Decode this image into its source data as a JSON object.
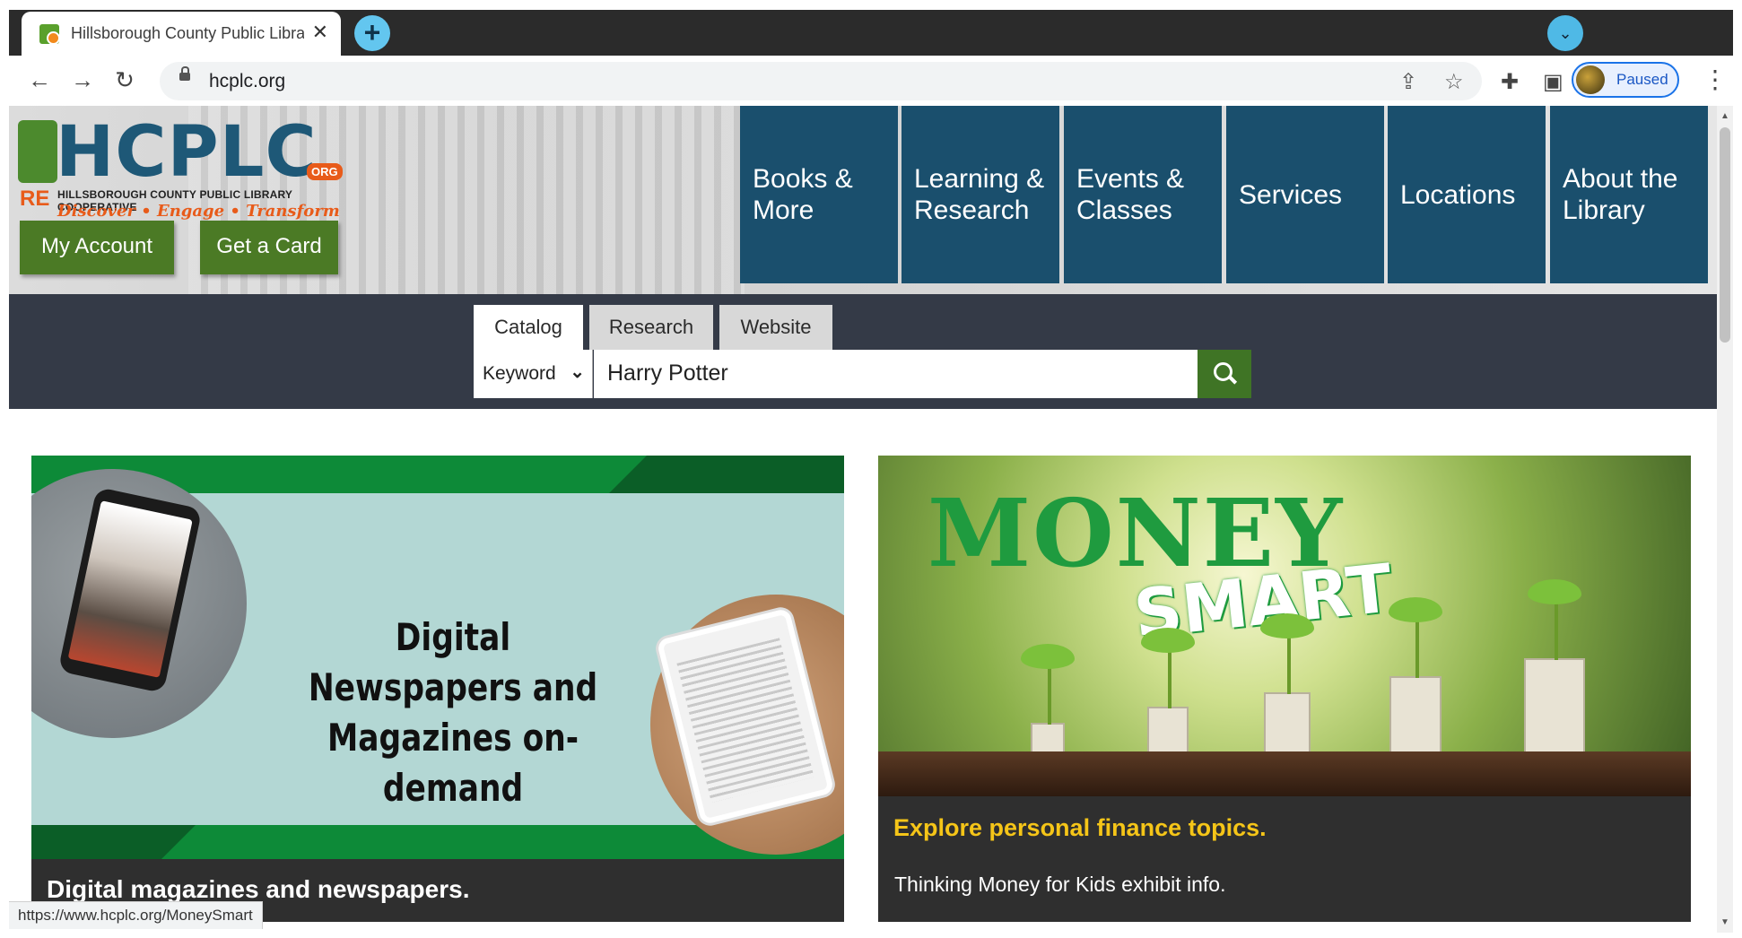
{
  "browser": {
    "tab_title": "Hillsborough County Public Library Cooperative",
    "new_tab_icon": "plus-icon",
    "url": "hcplc.org",
    "profile_label": "Paused",
    "status_url": "https://www.hcplc.org/MoneySmart"
  },
  "header": {
    "logo_text": "HCPLC",
    "logo_org": "ORG",
    "logo_re": "RE",
    "logo_subtitle": "HILLSBOROUGH COUNTY PUBLIC LIBRARY COOPERATIVE",
    "logo_tagline": "Discover • Engage • Transform",
    "my_account": "My Account",
    "get_card": "Get a Card",
    "nav": [
      {
        "line1": "Books &",
        "line2": "More"
      },
      {
        "line1": "Learning &",
        "line2": "Research"
      },
      {
        "line1": "Events &",
        "line2": "Classes"
      },
      {
        "line1": "Services",
        "line2": ""
      },
      {
        "line1": "Locations",
        "line2": ""
      },
      {
        "line1": "About the",
        "line2": "Library"
      }
    ]
  },
  "search": {
    "tabs": [
      "Catalog",
      "Research",
      "Website"
    ],
    "active_tab": "Catalog",
    "scope": "Keyword",
    "query": "Harry Potter"
  },
  "cards": [
    {
      "image_heading_line1": "Digital Newspapers and",
      "image_heading_line2": "Magazines on-demand",
      "caption": "Digital magazines and newspapers."
    },
    {
      "image_title1": "MONEY",
      "image_title2": "SMART",
      "caption": "Explore personal finance topics.",
      "subcaption": "Thinking Money for Kids exhibit info."
    }
  ],
  "colors": {
    "nav_tile": "#1a4f6d",
    "green_button": "#4b7a25",
    "search_band": "#343a47",
    "accent_yellow": "#f5c518"
  }
}
